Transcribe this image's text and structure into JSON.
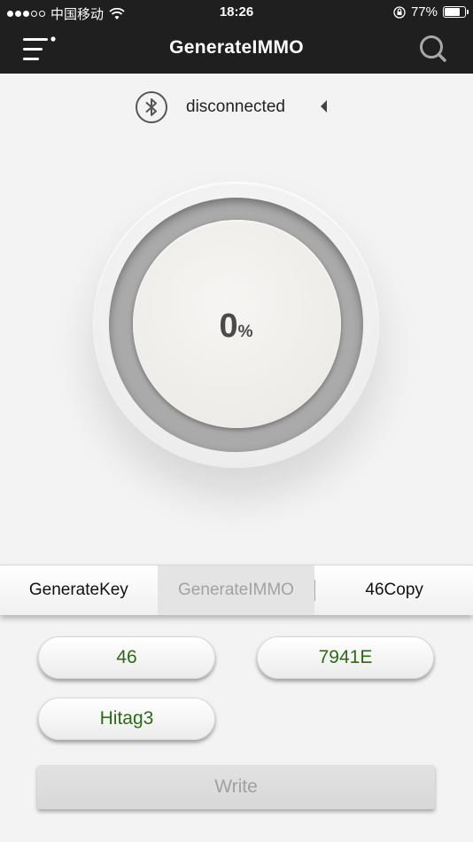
{
  "status_bar": {
    "carrier": "中国移动",
    "time": "18:26",
    "battery_percent": "77%",
    "battery_level": 0.77,
    "signal_bars_filled": 3,
    "signal_bars_total": 5
  },
  "header": {
    "title": "GenerateIMMO",
    "menu_icon": "menu-icon",
    "search_icon": "search-icon"
  },
  "bluetooth": {
    "status": "disconnected",
    "icon": "bluetooth-icon"
  },
  "progress": {
    "value": "0",
    "unit": "%"
  },
  "tabs": [
    {
      "label": "GenerateKey",
      "active": false
    },
    {
      "label": "GenerateIMMO",
      "active": true
    },
    {
      "label": "46Copy",
      "active": false
    }
  ],
  "options": {
    "opt1": "46",
    "opt2": "7941E",
    "opt3": "Hitag3"
  },
  "write_button": {
    "label": "Write"
  },
  "colors": {
    "bar_background": "#1f1f1f",
    "option_text": "#2c6b12",
    "disabled_text": "#a0a0a0"
  }
}
